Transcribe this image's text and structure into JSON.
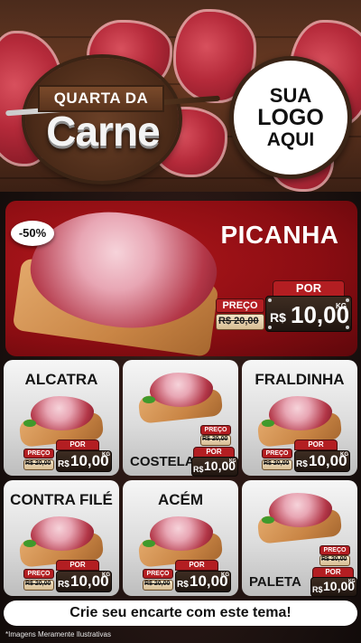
{
  "header": {
    "campaign_top": "QUARTA DA",
    "campaign_main": "Carne",
    "logo_line1": "SUA",
    "logo_line2": "LOGO",
    "logo_line3": "AQUI"
  },
  "featured": {
    "discount": "-50%",
    "name": "PICANHA",
    "preco_label": "PREÇO",
    "por_label": "POR",
    "old_price": "R$ 20,00",
    "currency": "R$",
    "new_price": "10,00",
    "unit": "KG"
  },
  "products": [
    {
      "name": "ALCATRA",
      "preco_label": "PREÇO",
      "por_label": "POR",
      "old_price": "R$ 20,00",
      "currency": "R$",
      "new_price": "10,00",
      "unit": "KG"
    },
    {
      "name": "COSTELA",
      "preco_label": "PREÇO",
      "por_label": "POR",
      "old_price": "R$ 20,00",
      "currency": "R$",
      "new_price": "10,00",
      "unit": "KG"
    },
    {
      "name": "FRALDINHA",
      "preco_label": "PREÇO",
      "por_label": "POR",
      "old_price": "R$ 20,00",
      "currency": "R$",
      "new_price": "10,00",
      "unit": "KG"
    },
    {
      "name": "CONTRA FILÉ",
      "preco_label": "PREÇO",
      "por_label": "POR",
      "old_price": "R$ 20,00",
      "currency": "R$",
      "new_price": "10,00",
      "unit": "KG"
    },
    {
      "name": "ACÉM",
      "preco_label": "PREÇO",
      "por_label": "POR",
      "old_price": "R$ 20,00",
      "currency": "R$",
      "new_price": "10,00",
      "unit": "KG"
    },
    {
      "name": "PALETA",
      "preco_label": "PREÇO",
      "por_label": "POR",
      "old_price": "R$ 20,00",
      "currency": "R$",
      "new_price": "10,00",
      "unit": "KG"
    }
  ],
  "cta": "Crie seu encarte com este tema!",
  "disclaimer": "*Imagens Meramente Ilustrativas",
  "colors": {
    "accent": "#b31e22",
    "hero_bg": "#8a0d12",
    "card_bg": "#dcdcdc",
    "price_bg": "#2a1c14"
  }
}
